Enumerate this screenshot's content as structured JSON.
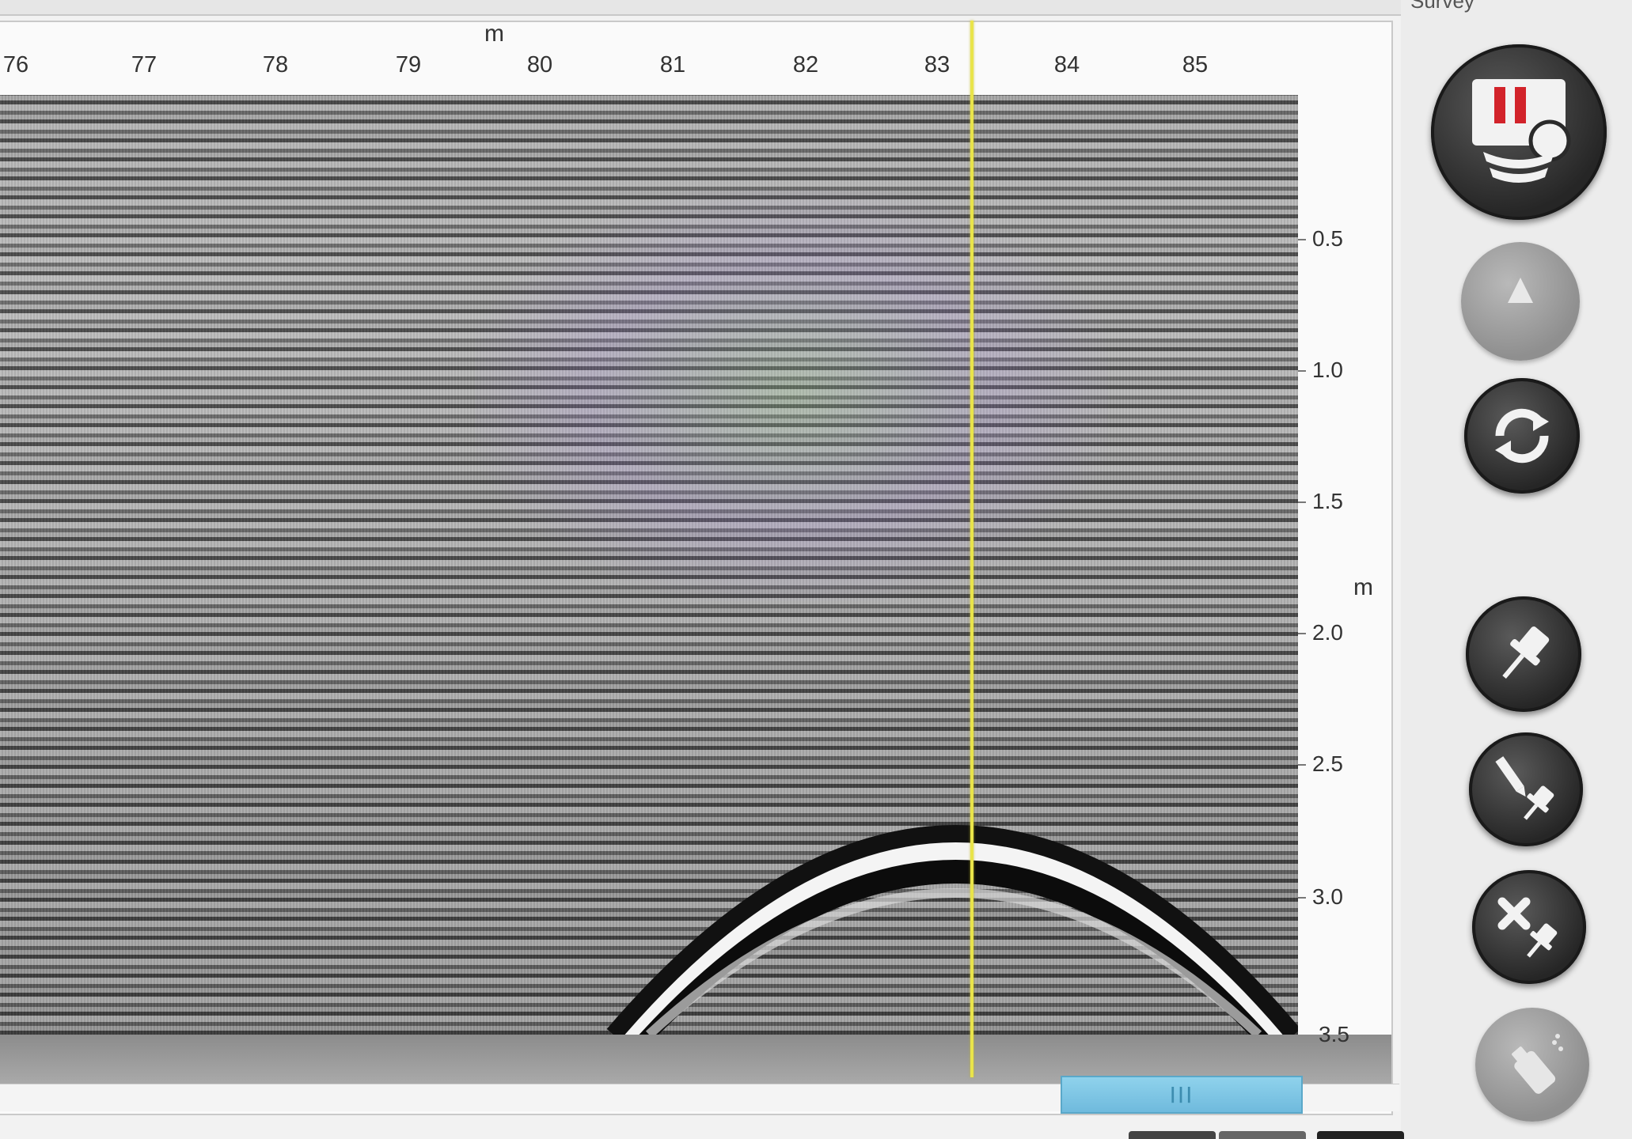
{
  "panel": {
    "label": "Survey"
  },
  "x_axis": {
    "unit": "m",
    "ticks": [
      "76",
      "77",
      "78",
      "79",
      "80",
      "81",
      "82",
      "83",
      "84",
      "85"
    ]
  },
  "y_axis": {
    "unit": "m",
    "ticks": [
      "0.5",
      "1.0",
      "1.5",
      "2.0",
      "2.5",
      "3.0",
      "3.5"
    ]
  },
  "scrollbar": {
    "grip": "III"
  },
  "toolbar": {
    "buttons": [
      {
        "icon": "pause-scan-icon",
        "state": "active"
      },
      {
        "icon": "move-up-icon",
        "state": "disabled"
      },
      {
        "icon": "refresh-icon",
        "state": "active"
      },
      {
        "icon": "add-marker-icon",
        "state": "active"
      },
      {
        "icon": "edit-marker-icon",
        "state": "active"
      },
      {
        "icon": "delete-marker-icon",
        "state": "active"
      },
      {
        "icon": "spray-paint-icon",
        "state": "disabled"
      }
    ]
  },
  "colors": {
    "cursor": "#e9e44a",
    "pause_bars": "#d2232a",
    "scroll_thumb": "#7ec6e6"
  }
}
